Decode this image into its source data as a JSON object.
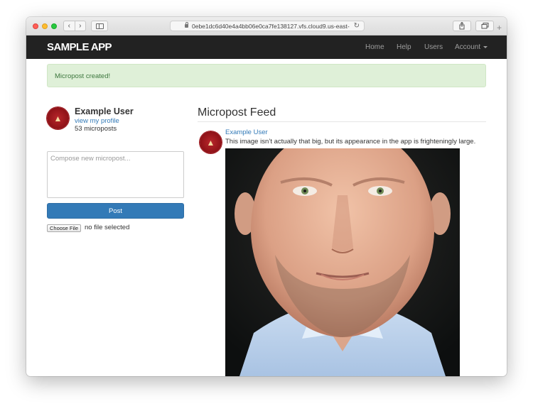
{
  "browser": {
    "url": "0ebe1dc6d40e4a4bb06e0ca7fe138127.vfs.cloud9.us-east-",
    "back_icon": "chevron-left-icon",
    "forward_icon": "chevron-right-icon",
    "sidebar_icon": "sidebar-icon",
    "share_icon": "share-icon",
    "tabs_icon": "tabs-icon",
    "new_tab_icon": "plus-icon"
  },
  "header": {
    "brand": "SAMPLE APP",
    "nav": {
      "home": "Home",
      "help": "Help",
      "users": "Users",
      "account": "Account"
    }
  },
  "flash": {
    "message": "Micropost created!",
    "color": "#dff0d8"
  },
  "user_info": {
    "name": "Example User",
    "profile_link": "view my profile",
    "micropost_count": "53 microposts"
  },
  "micropost_form": {
    "placeholder": "Compose new micropost...",
    "submit_label": "Post",
    "file_button": "Choose File",
    "file_status": "no file selected"
  },
  "feed": {
    "title": "Micropost Feed",
    "items": [
      {
        "user": "Example User",
        "content": "This image isn’t actually that big, but its appearance in the app is frighteningly large."
      }
    ]
  },
  "colors": {
    "navbar": "#222222",
    "primary": "#337ab7",
    "avatar": "#8d1117"
  }
}
